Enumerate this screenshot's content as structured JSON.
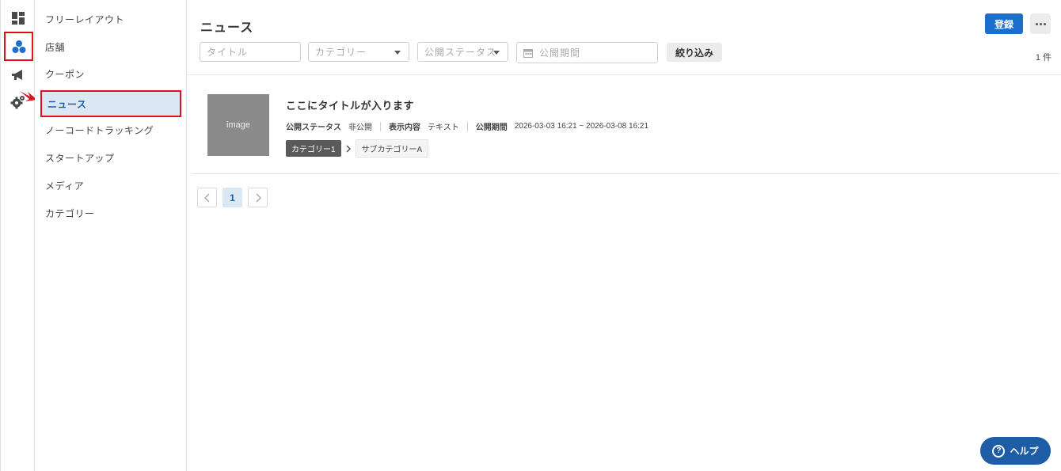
{
  "rail": {
    "items": [
      {
        "name": "dashboard-icon"
      },
      {
        "name": "content-icon"
      },
      {
        "name": "megaphone-icon"
      },
      {
        "name": "settings-icon"
      }
    ]
  },
  "sidebar": {
    "items": [
      {
        "label": "フリーレイアウト"
      },
      {
        "label": "店舗"
      },
      {
        "label": "クーポン"
      },
      {
        "label": "ニュース"
      },
      {
        "label": "ノーコードトラッキング"
      },
      {
        "label": "スタートアップ"
      },
      {
        "label": "メディア"
      },
      {
        "label": "カテゴリー"
      }
    ]
  },
  "header": {
    "title": "ニュース",
    "register_label": "登録"
  },
  "filters": {
    "title_placeholder": "タイトル",
    "category_label": "カテゴリー",
    "status_label": "公開ステータス",
    "period_placeholder": "公開期間",
    "apply_label": "絞り込み",
    "count": "1 件"
  },
  "news": {
    "items": [
      {
        "image_label": "image",
        "title": "ここにタイトルが入ります",
        "status_label": "公開ステータス",
        "status_value": "非公開",
        "content_label": "表示内容",
        "content_value": "テキスト",
        "period_label": "公開期間",
        "period_value": "2026-03-03 16:21 ~ 2026-03-08 16:21",
        "category": "カテゴリー1",
        "subcategory": "サブカテゴリーA"
      }
    ]
  },
  "pagination": {
    "current": "1"
  },
  "help": {
    "label": "ヘルプ"
  },
  "colors": {
    "accent": "#1e6fcc",
    "highlight": "#e0101f",
    "active_bg": "#dbe7f3",
    "help_bg": "#1d5da6"
  }
}
